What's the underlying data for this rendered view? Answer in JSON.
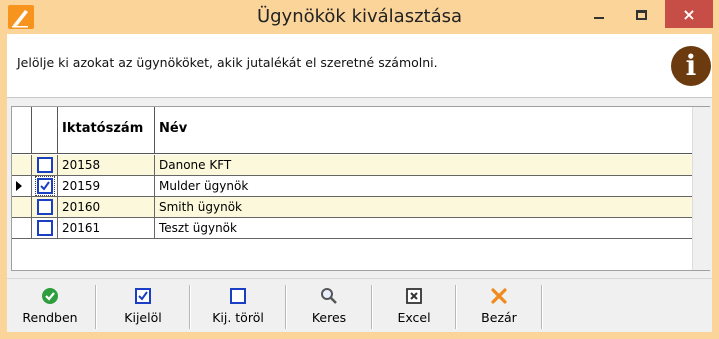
{
  "window": {
    "title": "Ügynökök kiválasztása",
    "app_icon": "pencil-app-icon",
    "controls": {
      "minimize": "minimize-icon",
      "maximize": "maximize-icon",
      "close": "×"
    },
    "close_color": "#c74d47",
    "frame_color": "#fbd49a"
  },
  "info": {
    "text": "Jelölje ki azokat az ügynököket, akik jutalékát el szeretné számolni.",
    "icon": "info-icon",
    "icon_glyph": "i",
    "icon_color": "#6b3a0e"
  },
  "grid": {
    "columns": [
      "",
      "",
      "Iktatószám",
      "Név"
    ],
    "rows": [
      {
        "checked": false,
        "current": false,
        "id": "20158",
        "name": "Danone KFT"
      },
      {
        "checked": true,
        "current": true,
        "id": "20159",
        "name": "Mulder ügynök"
      },
      {
        "checked": false,
        "current": false,
        "id": "20160",
        "name": "Smith ügynök"
      },
      {
        "checked": false,
        "current": false,
        "id": "20161",
        "name": "Teszt ügynök"
      }
    ],
    "alt_row_color": "#fcf8dc",
    "checkbox_color": "#1a3fc4"
  },
  "toolbar": {
    "buttons": [
      {
        "label": "Rendben",
        "icon": "ok-check-icon"
      },
      {
        "label": "Kijelöl",
        "icon": "checked-box-icon"
      },
      {
        "label": "Kij. töröl",
        "icon": "empty-box-icon"
      },
      {
        "label": "Keres",
        "icon": "search-icon"
      },
      {
        "label": "Excel",
        "icon": "excel-x-box-icon"
      },
      {
        "label": "Bezár",
        "icon": "close-x-icon"
      }
    ]
  }
}
